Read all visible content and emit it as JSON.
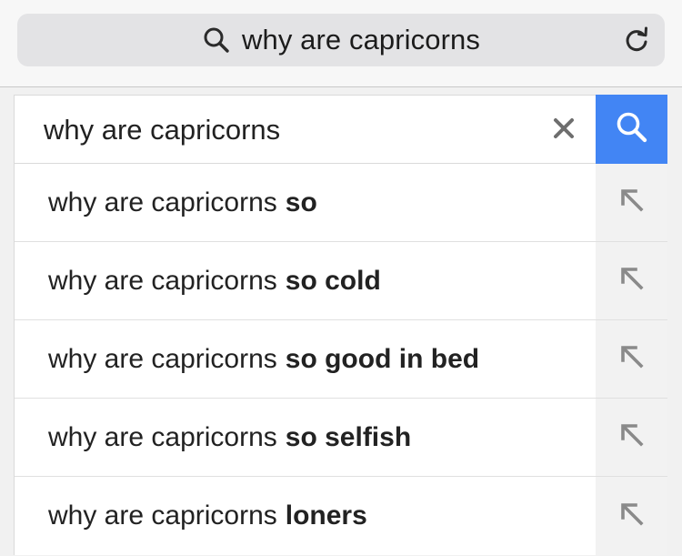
{
  "browser": {
    "address_text": "why are capricorns",
    "icons": {
      "address_search": "search-icon",
      "reload": "reload-icon"
    }
  },
  "search": {
    "query": "why are capricorns",
    "clear_icon": "close-icon",
    "submit_icon": "search-icon",
    "accent_color": "#4285f4"
  },
  "suggestions": [
    {
      "prefix": "why are capricorns",
      "completion": "so"
    },
    {
      "prefix": "why are capricorns",
      "completion": "so cold"
    },
    {
      "prefix": "why are capricorns",
      "completion": "so good in bed"
    },
    {
      "prefix": "why are capricorns",
      "completion": "so selfish"
    },
    {
      "prefix": "why are capricorns",
      "completion": "loners"
    }
  ],
  "suggestion_fill_icon": "arrow-up-left-icon"
}
